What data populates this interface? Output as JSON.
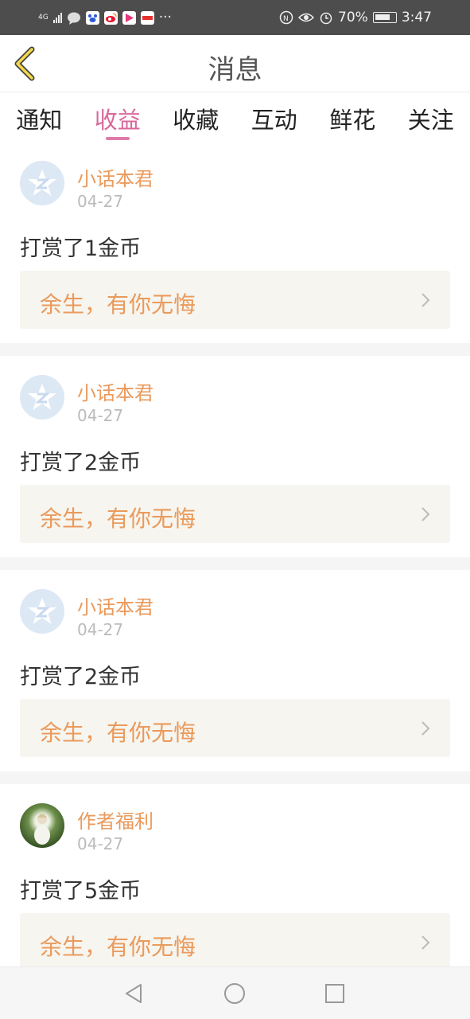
{
  "status_bar": {
    "network": "4G",
    "battery": "70%",
    "time": "3:47",
    "icons": [
      "signal-icon",
      "message-icon",
      "baidu-icon",
      "weibo-icon",
      "video-icon",
      "sohu-icon",
      "more-dots-icon",
      "vibrate-icon",
      "eye-comfort-icon",
      "alarm-icon",
      "battery-icon"
    ],
    "more": "···"
  },
  "header": {
    "title": "消息",
    "back_icon": "back-chevron-icon"
  },
  "tabs": [
    {
      "label": "通知"
    },
    {
      "label": "收益",
      "active": true
    },
    {
      "label": "收藏"
    },
    {
      "label": "互动"
    },
    {
      "label": "鲜花"
    },
    {
      "label": "关注"
    }
  ],
  "items": [
    {
      "name": "小话本君",
      "date": "04-27",
      "desc": "打赏了1金币",
      "book": "余生，有你无悔",
      "avatar": "default-star-avatar"
    },
    {
      "name": "小话本君",
      "date": "04-27",
      "desc": "打赏了2金币",
      "book": "余生，有你无悔",
      "avatar": "default-star-avatar"
    },
    {
      "name": "小话本君",
      "date": "04-27",
      "desc": "打赏了2金币",
      "book": "余生，有你无悔",
      "avatar": "default-star-avatar"
    },
    {
      "name": "作者福利",
      "date": "04-27",
      "desc": "打赏了5金币",
      "book": "余生，有你无悔",
      "avatar": "photo-avatar"
    }
  ],
  "colors": {
    "accent": "#d9689b",
    "name_orange": "#ea9a5c",
    "card_bg": "#f6f5ef"
  },
  "navbar": {
    "icons": [
      "back-triangle-icon",
      "home-circle-icon",
      "recents-square-icon"
    ]
  }
}
